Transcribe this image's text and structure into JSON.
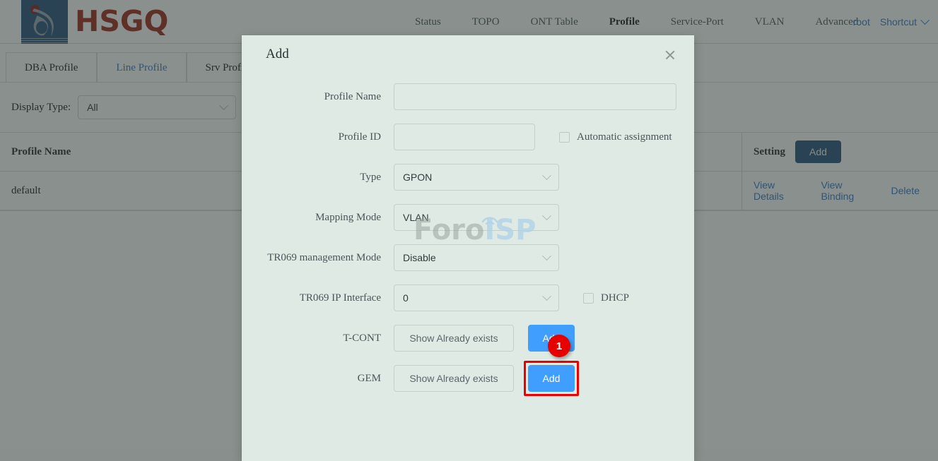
{
  "app": {
    "brand_name": "HSGQ",
    "logo_icon": "hsgq-flame-logo-icon"
  },
  "header": {
    "nav": [
      {
        "label": "Status",
        "active": false
      },
      {
        "label": "TOPO",
        "active": false
      },
      {
        "label": "ONT Table",
        "active": false
      },
      {
        "label": "Profile",
        "active": true
      },
      {
        "label": "Service-Port",
        "active": false
      },
      {
        "label": "VLAN",
        "active": false
      },
      {
        "label": "Advanced",
        "active": false
      }
    ],
    "user": "root",
    "shortcut_label": "Shortcut",
    "shortcut_icon": "chevron-down-icon"
  },
  "tabs": [
    {
      "label": "DBA Profile",
      "active": false
    },
    {
      "label": "Line Profile",
      "active": true
    },
    {
      "label": "Srv Profile",
      "active": false
    }
  ],
  "filter": {
    "label": "Display Type:",
    "value": "All",
    "icon": "chevron-down-icon"
  },
  "table": {
    "columns": [
      "Profile Name",
      "Setting"
    ],
    "header_add_label": "Add",
    "rows": [
      {
        "profile_name": "default",
        "actions": [
          "View Details",
          "View Binding",
          "Delete"
        ]
      }
    ]
  },
  "modal": {
    "title": "Add",
    "close_icon": "close-icon",
    "fields": {
      "profile_name": {
        "label": "Profile Name",
        "value": "",
        "placeholder": ""
      },
      "profile_id": {
        "label": "Profile ID",
        "value": "",
        "placeholder": "",
        "checkbox_label": "Automatic assignment",
        "checkbox_checked": false
      },
      "type": {
        "label": "Type",
        "value": "GPON",
        "icon": "chevron-down-icon"
      },
      "mapping_mode": {
        "label": "Mapping Mode",
        "value": "VLAN",
        "icon": "chevron-down-icon"
      },
      "tr069_management_mode": {
        "label": "TR069 management Mode",
        "value": "Disable",
        "icon": "chevron-down-icon"
      },
      "tr069_ip_interface": {
        "label": "TR069 IP Interface",
        "value": "0",
        "icon": "chevron-down-icon",
        "checkbox_label": "DHCP",
        "checkbox_checked": false
      },
      "tcont": {
        "label": "T-CONT",
        "show_label": "Show Already exists",
        "add_label": "Add"
      },
      "gem": {
        "label": "GEM",
        "show_label": "Show Already exists",
        "add_label": "Add",
        "highlight_badge": "1"
      }
    }
  },
  "watermark": {
    "text_primary": "Foro",
    "text_secondary": "ISP",
    "icon": "wifi-arc-icon"
  },
  "colors": {
    "brand_red": "#9e2a21",
    "brand_blue": "#2b5580",
    "link_blue": "#3a7bc8",
    "action_blue": "#409eff",
    "highlight_red": "#e60000",
    "modal_bg": "#dfeae4"
  }
}
